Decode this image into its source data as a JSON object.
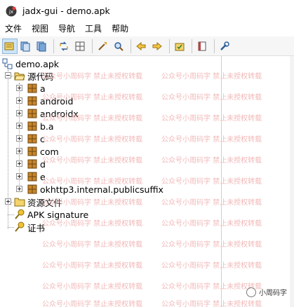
{
  "window": {
    "title": "jadx-gui - demo.apk"
  },
  "menu": [
    "文件",
    "视图",
    "导航",
    "工具",
    "帮助"
  ],
  "toolbar": {
    "buttons": [
      {
        "icon": "sync-tree-icon",
        "active": true
      },
      {
        "icon": "open-file-icon"
      },
      {
        "icon": "save-all-icon"
      },
      {
        "icon": "refresh-icon"
      },
      {
        "icon": "flatten-packages-icon"
      },
      {
        "icon": "search-text-icon"
      },
      {
        "icon": "find-class-icon"
      },
      {
        "icon": "back-icon"
      },
      {
        "icon": "forward-icon"
      },
      {
        "icon": "deobfuscation-icon"
      },
      {
        "icon": "log-viewer-icon"
      },
      {
        "icon": "preferences-icon"
      }
    ]
  },
  "tree": {
    "root": "demo.apk",
    "source_folder": "源代码",
    "packages": [
      "a",
      "android",
      "androidx",
      "b.a",
      "c",
      "com",
      "d",
      "e",
      "okhttp3.internal.publicsuffix"
    ],
    "resources": "资源文件",
    "apk_signature": "APK signature",
    "certificate": "证书"
  },
  "watermark": {
    "text": "公众号小周码字 禁止未授权转载",
    "account": "小周码字"
  },
  "colors": {
    "package_icon": "#c8862a",
    "folder": "#e6b640",
    "key": "#d9a520",
    "watermark": "#f2b8b8",
    "selection": "#cde4f7"
  }
}
